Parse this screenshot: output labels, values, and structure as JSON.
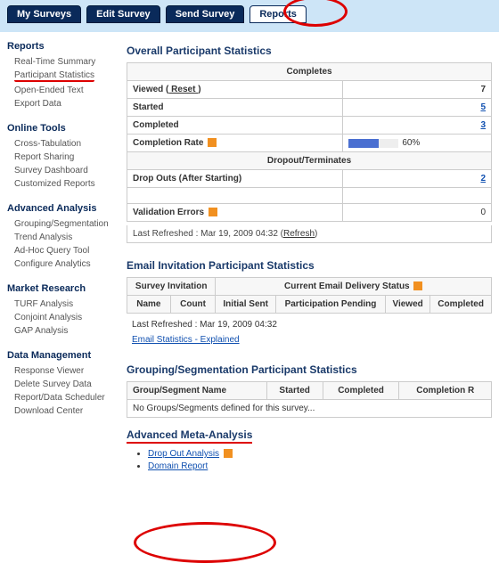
{
  "nav": {
    "my_surveys": "My Surveys",
    "edit_survey": "Edit Survey",
    "send_survey": "Send Survey",
    "reports": "Reports"
  },
  "sidebar": {
    "groups": [
      {
        "title": "Reports",
        "items": [
          "Real-Time Summary",
          "Participant Statistics",
          "Open-Ended Text",
          "Export Data"
        ],
        "highlight_index": 1
      },
      {
        "title": "Online Tools",
        "items": [
          "Cross-Tabulation",
          "Report Sharing",
          "Survey Dashboard",
          "Customized Reports"
        ]
      },
      {
        "title": "Advanced Analysis",
        "items": [
          "Grouping/Segmentation",
          "Trend Analysis",
          "Ad-Hoc Query Tool",
          "Configure Analytics"
        ]
      },
      {
        "title": "Market Research",
        "items": [
          "TURF Analysis",
          "Conjoint Analysis",
          "GAP Analysis"
        ]
      },
      {
        "title": "Data Management",
        "items": [
          "Response Viewer",
          "Delete Survey Data",
          "Report/Data Scheduler",
          "Download Center"
        ]
      }
    ]
  },
  "overall": {
    "title": "Overall Participant Statistics",
    "completes_header": "Completes",
    "viewed_label": "Viewed (",
    "reset_text": " Reset ",
    "viewed_close": ")",
    "viewed_value": "7",
    "started_label": "Started",
    "started_value": "5",
    "completed_label": "Completed",
    "completed_value": "3",
    "cr_label": "Completion Rate",
    "cr_text": "60%",
    "cr_pct": 60,
    "dropout_header": "Dropout/Terminates",
    "dropouts_label": "Drop Outs (After Starting)",
    "dropouts_value": "2",
    "blank_label": "",
    "blank_value": "",
    "val_err_label": "Validation Errors",
    "val_err_value": "0",
    "refreshed_prefix": "Last Refreshed : Mar 19, 2009 04:32 (",
    "refresh_link": "Refresh",
    "refreshed_suffix": ")"
  },
  "email": {
    "title": "Email Invitation Participant Statistics",
    "survey_inv": "Survey Invitation",
    "curr_status": "Current Email Delivery Status",
    "name": "Name",
    "count": "Count",
    "initial_sent": "Initial Sent",
    "part_pending": "Participation Pending",
    "viewed": "Viewed",
    "completed": "Completed",
    "refreshed": "Last Refreshed : Mar 19, 2009 04:32",
    "explained": "Email Statistics - Explained"
  },
  "grouping": {
    "title": "Grouping/Segmentation Participant Statistics",
    "col_name": "Group/Segment Name",
    "col_started": "Started",
    "col_completed": "Completed",
    "col_cr": "Completion R",
    "empty": "No Groups/Segments defined for this survey..."
  },
  "meta": {
    "title": "Advanced Meta-Analysis",
    "dropout": "Drop Out Analysis",
    "domain": "Domain Report"
  }
}
